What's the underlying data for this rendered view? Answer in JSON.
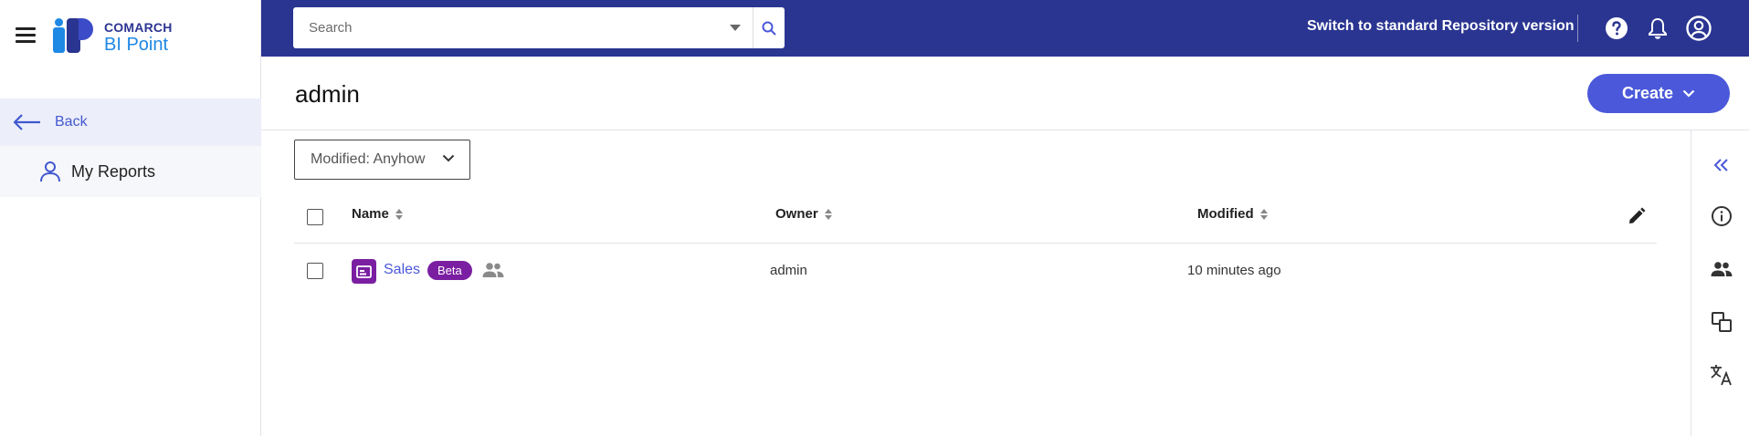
{
  "app": {
    "brand_line1": "COMARCH",
    "brand_line2": "BI Point"
  },
  "sidebar": {
    "back_label": "Back",
    "items": [
      {
        "label": "My Reports",
        "icon": "person-icon"
      }
    ]
  },
  "topbar": {
    "search_placeholder": "Search",
    "switch_label": "Switch to standard Repository version",
    "icons": [
      "help-icon",
      "bell-icon",
      "account-icon"
    ]
  },
  "header": {
    "title": "admin",
    "create_label": "Create"
  },
  "filter": {
    "label": "Modified: Anyhow"
  },
  "table": {
    "columns": [
      "Name",
      "Owner",
      "Modified"
    ],
    "rows": [
      {
        "name": "Sales",
        "badge": "Beta",
        "owner": "admin",
        "modified": "10 minutes ago"
      }
    ]
  },
  "right_panel": {
    "icons": [
      "collapse-icon",
      "info-icon",
      "share-icon",
      "copy-icon",
      "translate-icon"
    ]
  },
  "colors": {
    "topbar": "#2a3591",
    "accent": "#4a58d9",
    "badge": "#7b1fa2"
  }
}
